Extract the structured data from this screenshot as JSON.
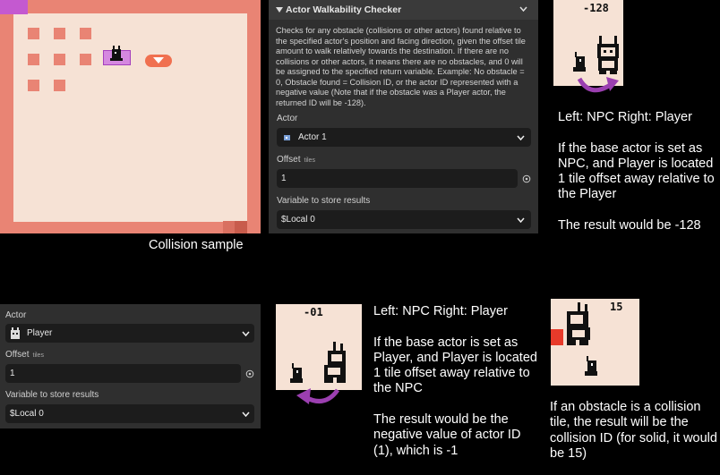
{
  "sample": {
    "caption": "Collision sample"
  },
  "checker": {
    "title": "Actor Walkability Checker",
    "description": "Checks for any obstacle (collisions or other actors) found relative to the specified actor's position and facing direction, given the offset tile amount to walk relatively towards the destination. If there are no collisions or other actors, it means there are no obstacles, and 0 will be assigned to the specified return variable. Example: No obstacle = 0, Obstacle found = Collision ID, or the actor ID represented with a negative value (Note that if the obstacle was a Player actor, the returned ID will be -128).",
    "actor_label": "Actor",
    "actor_value": "Actor 1",
    "offset_label": "Offset",
    "offset_unit": "tiles",
    "offset_value": "1",
    "variable_label": "Variable to store results",
    "variable_value": "$Local 0"
  },
  "checker2": {
    "actor_label": "Actor",
    "actor_value": "Player",
    "offset_label": "Offset",
    "offset_unit": "tiles",
    "offset_value": "1",
    "variable_label": "Variable to store results",
    "variable_value": "$Local 0"
  },
  "example1": {
    "counter": "-128",
    "text": "Left: NPC Right: Player\n\nIf the base actor is set as NPC, and Player is located 1 tile offset away relative to the Player\n\nThe result would be -128"
  },
  "example2": {
    "counter": "-01",
    "text": "Left: NPC Right: Player\n\nIf the base actor is set as Player, and Player is located 1 tile offset away relative to the NPC\n\nThe result would be the negative value of actor ID (1), which is -1"
  },
  "example3": {
    "counter": "15",
    "text": "If an obstacle is a collision tile, the result will be the collision ID (for solid, it would be 15)"
  },
  "colors": {
    "collision": "#e98474",
    "floor": "#f6e2d5",
    "arrow": "#9b3fb0",
    "panel": "#2f2f2f"
  }
}
